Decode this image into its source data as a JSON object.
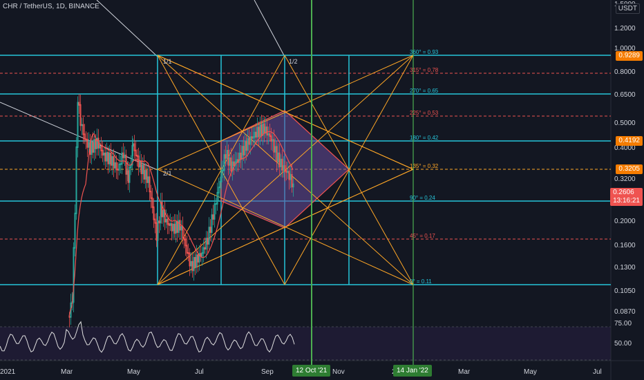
{
  "header": {
    "symbol_title": "CHR / TetherUS, 1D, BINANCE",
    "unit_button": "USDT"
  },
  "price_axis": {
    "ticks": [
      "1.5000",
      "1.2000",
      "1.0000",
      "0.8000",
      "0.6500",
      "0.5000",
      "0.4000",
      "0.3200",
      "0.2000",
      "0.1600",
      "0.1300",
      "0.1050",
      "0.0870"
    ],
    "tags": {
      "top": "0.9289",
      "upper": "0.4192",
      "mid": "0.3205",
      "last": "0.2606",
      "countdown": "13:16:21"
    }
  },
  "rsi_axis": {
    "ticks": [
      "75.00",
      "50.00"
    ]
  },
  "time_axis": {
    "labels": [
      "2021",
      "Mar",
      "May",
      "Jul",
      "Sep",
      "Nov",
      "2",
      "Mar",
      "May",
      "Jul"
    ],
    "date_tags": [
      "12 Oct '21",
      "14 Jan '22"
    ]
  },
  "gann_labels": {
    "ratio_1_1": "1/1",
    "ratio_1_2": "1/2",
    "ratio_2_1": "2/1",
    "degree_levels": [
      "360° = 0.93",
      "315° = 0.78",
      "270° = 0.65",
      "225° = 0.53",
      "180° = 0.42",
      "135° = 0.32",
      "90° = 0.24",
      "45° = 0.17",
      "0° = 0.11"
    ]
  },
  "colors": {
    "background": "#131722",
    "cyan": "#26c6da",
    "orange": "#ffa726",
    "red_dashed": "#ef5350",
    "green_vertical": "#4caf50",
    "up_candle": "#26a69a",
    "down_candle": "#ef5350",
    "rsi_line": "#e0e0e0",
    "hexagon_fill": "#6a4c9c"
  }
}
